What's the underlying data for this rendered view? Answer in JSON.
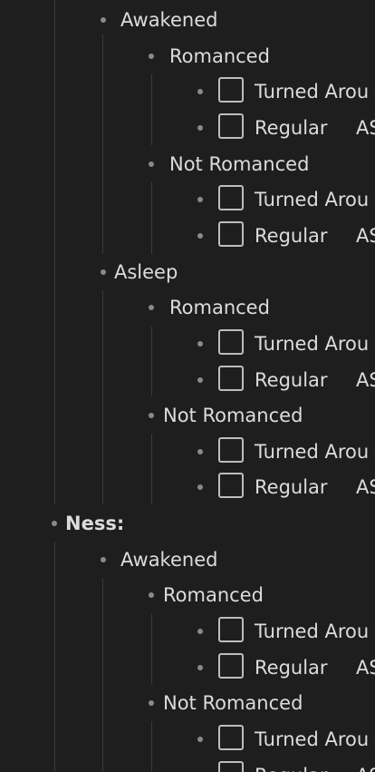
{
  "items": [
    {
      "depth": 2,
      "text": "Awakened",
      "task": false
    },
    {
      "depth": 3,
      "text": "Romanced",
      "task": false
    },
    {
      "depth": 4,
      "text": "Turned Arou",
      "task": true
    },
    {
      "depth": 4,
      "text": "Regular",
      "tail": "AS",
      "task": true
    },
    {
      "depth": 3,
      "text": "Not Romanced",
      "task": false
    },
    {
      "depth": 4,
      "text": "Turned Arou",
      "task": true
    },
    {
      "depth": 4,
      "text": "Regular",
      "tail": "AS",
      "task": true
    },
    {
      "depth": 2,
      "text": "Asleep",
      "task": false
    },
    {
      "depth": 3,
      "text": "Romanced",
      "task": false
    },
    {
      "depth": 4,
      "text": "Turned Arou",
      "task": true
    },
    {
      "depth": 4,
      "text": "Regular",
      "tail": "AS",
      "task": true
    },
    {
      "depth": 3,
      "text": "Not Romanced",
      "task": false
    },
    {
      "depth": 4,
      "text": "Turned Arou",
      "task": true
    },
    {
      "depth": 4,
      "text": "Regular",
      "tail": "AS",
      "task": true
    },
    {
      "depth": 1,
      "text": "Ness:",
      "task": false,
      "bold": true
    },
    {
      "depth": 2,
      "text": "Awakened",
      "task": false
    },
    {
      "depth": 3,
      "text": "Romanced",
      "task": false
    },
    {
      "depth": 4,
      "text": "Turned Arou",
      "task": true
    },
    {
      "depth": 4,
      "text": "Regular",
      "tail": "AS",
      "task": true
    },
    {
      "depth": 3,
      "text": "Not Romanced",
      "task": false
    },
    {
      "depth": 4,
      "text": "Turned Arou",
      "task": true
    },
    {
      "depth": 4,
      "text": "Regular",
      "tail": "AS",
      "task": true
    }
  ]
}
